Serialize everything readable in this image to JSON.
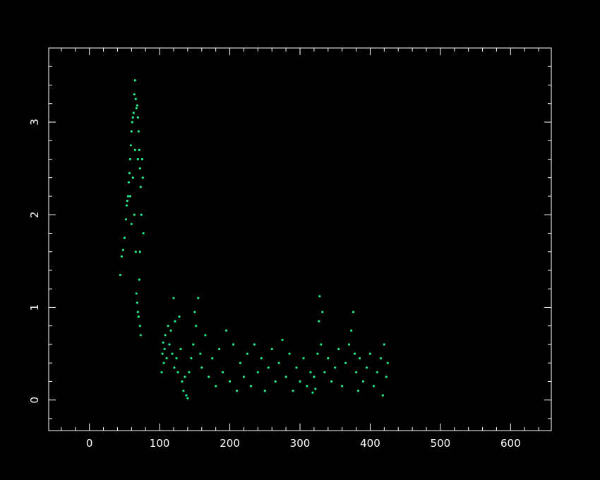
{
  "chart_data": {
    "type": "scatter",
    "title": "",
    "xlabel": "",
    "ylabel": "",
    "xlim": [
      -58,
      658
    ],
    "ylim": [
      -0.33,
      3.8
    ],
    "grid": false,
    "x_ticks": [
      {
        "value": 0,
        "label": "0"
      },
      {
        "value": 100,
        "label": "100"
      },
      {
        "value": 200,
        "label": "200"
      },
      {
        "value": 300,
        "label": "300"
      },
      {
        "value": 400,
        "label": "400"
      },
      {
        "value": 500,
        "label": "500"
      },
      {
        "value": 600,
        "label": "600"
      }
    ],
    "y_ticks": [
      {
        "value": 0,
        "label": "0"
      },
      {
        "value": 1,
        "label": "1"
      },
      {
        "value": 2,
        "label": "2"
      },
      {
        "value": 3,
        "label": "3"
      }
    ],
    "x_minor_step": 20,
    "y_minor_step": 0.2,
    "colors": {
      "background": "#000000",
      "axes": "#ffffff",
      "points": "#22ee88"
    },
    "series": [
      {
        "points": [
          [
            44,
            1.35
          ],
          [
            46,
            1.55
          ],
          [
            48,
            1.62
          ],
          [
            50,
            1.75
          ],
          [
            52,
            1.95
          ],
          [
            53,
            2.1
          ],
          [
            54,
            2.15
          ],
          [
            55,
            2.2
          ],
          [
            56,
            2.35
          ],
          [
            57,
            2.45
          ],
          [
            58,
            2.6
          ],
          [
            59,
            2.75
          ],
          [
            60,
            2.9
          ],
          [
            61,
            3.0
          ],
          [
            62,
            3.05
          ],
          [
            63,
            3.1
          ],
          [
            64,
            3.3
          ],
          [
            65,
            3.45
          ],
          [
            66,
            3.25
          ],
          [
            67,
            3.15
          ],
          [
            68,
            3.18
          ],
          [
            69,
            3.05
          ],
          [
            70,
            2.9
          ],
          [
            71,
            2.7
          ],
          [
            72,
            2.5
          ],
          [
            73,
            2.3
          ],
          [
            74,
            2.0
          ],
          [
            75,
            2.6
          ],
          [
            76,
            2.4
          ],
          [
            77,
            1.8
          ],
          [
            62,
            2.4
          ],
          [
            64,
            2.0
          ],
          [
            66,
            1.6
          ],
          [
            67,
            1.15
          ],
          [
            68,
            1.05
          ],
          [
            69,
            0.95
          ],
          [
            70,
            0.9
          ],
          [
            72,
            0.8
          ],
          [
            73,
            0.7
          ],
          [
            71,
            1.3
          ],
          [
            60,
            1.9
          ],
          [
            58,
            2.2
          ],
          [
            65,
            2.7
          ],
          [
            69,
            2.6
          ],
          [
            72,
            1.6
          ],
          [
            103,
            0.3
          ],
          [
            104,
            0.5
          ],
          [
            105,
            0.62
          ],
          [
            106,
            0.4
          ],
          [
            107,
            0.55
          ],
          [
            108,
            0.7
          ],
          [
            110,
            0.45
          ],
          [
            112,
            0.8
          ],
          [
            114,
            0.6
          ],
          [
            116,
            0.75
          ],
          [
            118,
            0.5
          ],
          [
            120,
            1.1
          ],
          [
            121,
            0.35
          ],
          [
            122,
            0.85
          ],
          [
            124,
            0.45
          ],
          [
            126,
            0.3
          ],
          [
            128,
            0.9
          ],
          [
            130,
            0.55
          ],
          [
            132,
            0.2
          ],
          [
            134,
            0.1
          ],
          [
            136,
            0.25
          ],
          [
            138,
            0.05
          ],
          [
            140,
            0.02
          ],
          [
            142,
            0.3
          ],
          [
            145,
            0.45
          ],
          [
            148,
            0.6
          ],
          [
            150,
            0.95
          ],
          [
            152,
            0.8
          ],
          [
            155,
            1.1
          ],
          [
            158,
            0.5
          ],
          [
            160,
            0.35
          ],
          [
            165,
            0.7
          ],
          [
            170,
            0.25
          ],
          [
            175,
            0.45
          ],
          [
            180,
            0.15
          ],
          [
            185,
            0.55
          ],
          [
            190,
            0.3
          ],
          [
            195,
            0.75
          ],
          [
            200,
            0.2
          ],
          [
            205,
            0.6
          ],
          [
            210,
            0.1
          ],
          [
            215,
            0.4
          ],
          [
            220,
            0.25
          ],
          [
            225,
            0.5
          ],
          [
            230,
            0.15
          ],
          [
            235,
            0.6
          ],
          [
            240,
            0.3
          ],
          [
            245,
            0.45
          ],
          [
            250,
            0.1
          ],
          [
            255,
            0.35
          ],
          [
            260,
            0.55
          ],
          [
            265,
            0.2
          ],
          [
            270,
            0.4
          ],
          [
            275,
            0.65
          ],
          [
            280,
            0.25
          ],
          [
            285,
            0.5
          ],
          [
            290,
            0.1
          ],
          [
            295,
            0.35
          ],
          [
            300,
            0.2
          ],
          [
            305,
            0.45
          ],
          [
            310,
            0.15
          ],
          [
            315,
            0.3
          ],
          [
            318,
            0.08
          ],
          [
            320,
            0.25
          ],
          [
            322,
            0.12
          ],
          [
            325,
            0.5
          ],
          [
            327,
            0.85
          ],
          [
            328,
            1.12
          ],
          [
            330,
            0.6
          ],
          [
            332,
            0.95
          ],
          [
            335,
            0.3
          ],
          [
            340,
            0.45
          ],
          [
            345,
            0.2
          ],
          [
            350,
            0.35
          ],
          [
            355,
            0.55
          ],
          [
            360,
            0.15
          ],
          [
            365,
            0.4
          ],
          [
            370,
            0.6
          ],
          [
            373,
            0.75
          ],
          [
            376,
            0.95
          ],
          [
            378,
            0.5
          ],
          [
            380,
            0.3
          ],
          [
            383,
            0.1
          ],
          [
            385,
            0.45
          ],
          [
            390,
            0.2
          ],
          [
            395,
            0.35
          ],
          [
            400,
            0.5
          ],
          [
            405,
            0.15
          ],
          [
            410,
            0.3
          ],
          [
            415,
            0.45
          ],
          [
            418,
            0.05
          ],
          [
            420,
            0.6
          ],
          [
            423,
            0.25
          ],
          [
            425,
            0.4
          ]
        ]
      }
    ]
  }
}
